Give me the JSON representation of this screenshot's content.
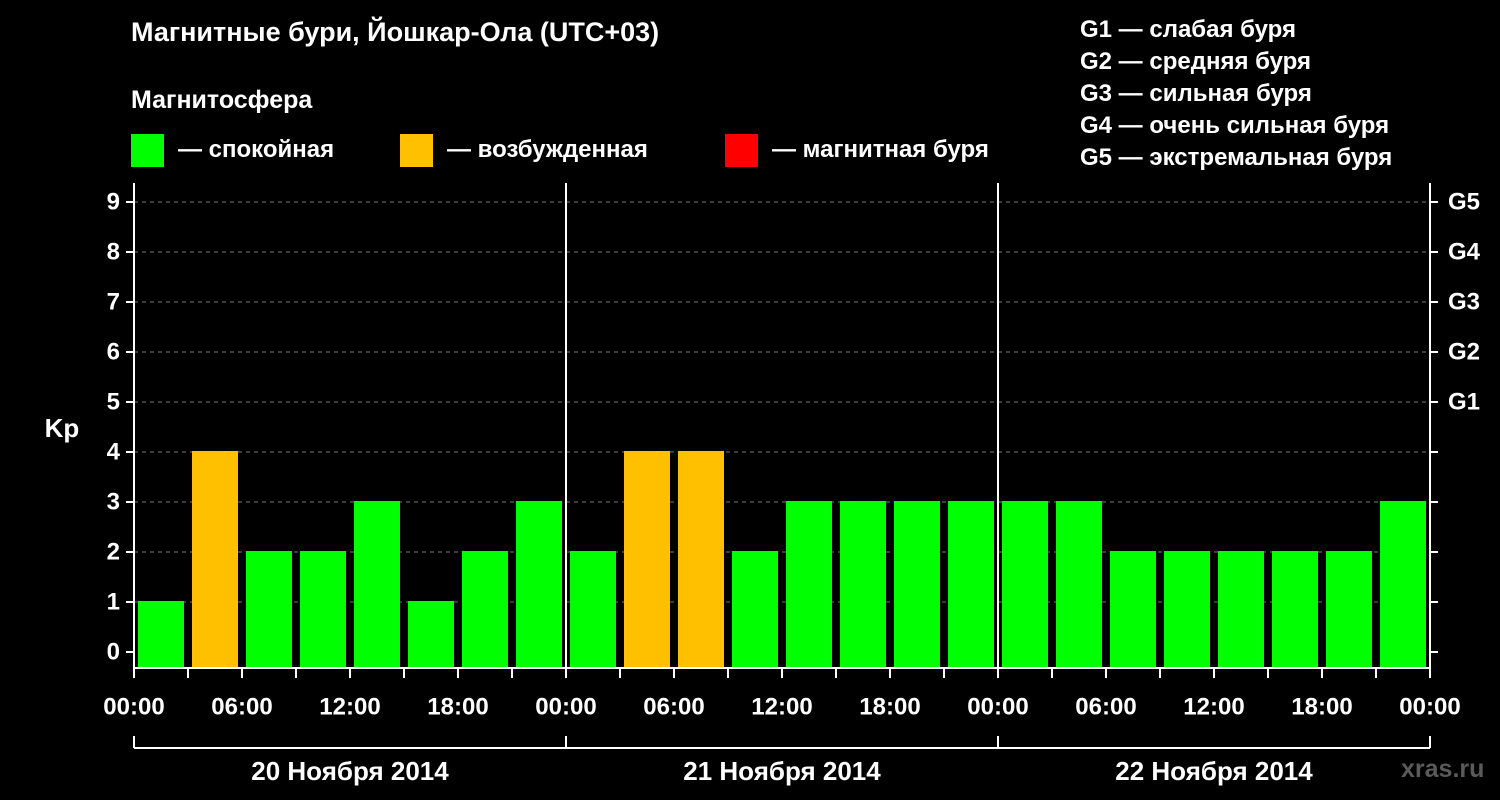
{
  "chart_data": {
    "type": "bar",
    "title": "Магнитные бури, Йошкар-Ола (UTC+03)",
    "subtitle": "Магнитосфера",
    "ylabel": "Kp",
    "ylim": [
      0,
      9
    ],
    "yticks": [
      "0",
      "1",
      "2",
      "3",
      "4",
      "5",
      "6",
      "7",
      "8",
      "9"
    ],
    "gticks": [
      {
        "kp": 5,
        "label": "G1"
      },
      {
        "kp": 6,
        "label": "G2"
      },
      {
        "kp": 7,
        "label": "G3"
      },
      {
        "kp": 8,
        "label": "G4"
      },
      {
        "kp": 9,
        "label": "G5"
      }
    ],
    "xtick_labels": [
      "00:00",
      "06:00",
      "12:00",
      "18:00",
      "00:00",
      "06:00",
      "12:00",
      "18:00",
      "00:00",
      "06:00",
      "12:00",
      "18:00",
      "00:00"
    ],
    "days": [
      "20 Ноября 2014",
      "21 Ноября 2014",
      "22 Ноября 2014"
    ],
    "values": [
      1,
      4,
      2,
      2,
      3,
      1,
      2,
      3,
      2,
      4,
      4,
      2,
      3,
      3,
      3,
      3,
      3,
      3,
      2,
      2,
      2,
      2,
      2,
      3
    ],
    "grid": "dashed horizontal",
    "colors": {
      "quiet": "#00ff00",
      "excited": "#ffc000",
      "storm": "#ff0000"
    }
  },
  "legend": {
    "quiet": "— спокойная",
    "excited": "— возбужденная",
    "storm": "— магнитная буря"
  },
  "g_legend": [
    "G1 — слабая буря",
    "G2 — средняя буря",
    "G3 — сильная буря",
    "G4 — очень сильная буря",
    "G5 — экстремальная буря"
  ],
  "watermark": "xras.ru"
}
